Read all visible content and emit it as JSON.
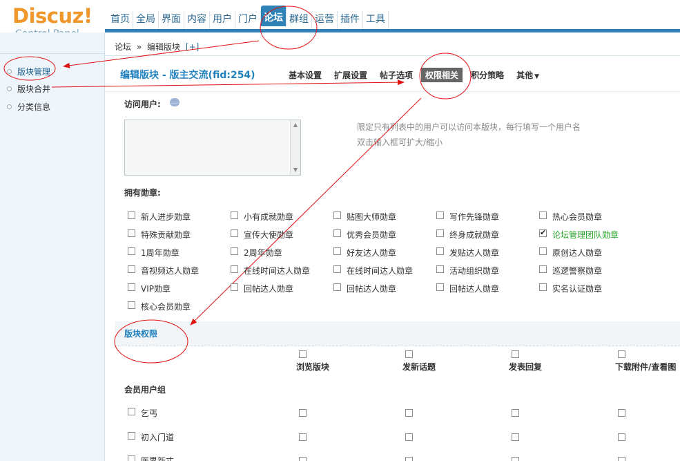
{
  "logo": {
    "brand": "Discuz!",
    "subtitle": "Control Panel"
  },
  "top_nav": [
    "首页",
    "全局",
    "界面",
    "内容",
    "用户",
    "门户",
    "论坛",
    "群组",
    "运营",
    "插件",
    "工具"
  ],
  "top_nav_active": "论坛",
  "sidebar": {
    "items": [
      {
        "label": "版块管理",
        "active": true
      },
      {
        "label": "版块合并",
        "active": false
      },
      {
        "label": "分类信息",
        "active": false
      }
    ]
  },
  "breadcrumb": {
    "root": "论坛",
    "sep": "»",
    "current": "编辑版块",
    "toggle": "[+]"
  },
  "page": {
    "title": "编辑版块 - 版主交流(fid:254)",
    "tabs": [
      "基本设置",
      "扩展设置",
      "帖子选项",
      "权限相关",
      "积分策略",
      "其他"
    ],
    "active_tab": "权限相关",
    "more_caret": "▼"
  },
  "access": {
    "label": "访问用户:",
    "help_icon": "help-bubble-icon",
    "hint1": "限定只有列表中的用户可以访问本版块，每行填写一个用户名",
    "hint2": "双击输入框可扩大/缩小"
  },
  "medals": {
    "label": "拥有勋章:",
    "items": [
      {
        "name": "新人进步勋章",
        "checked": false
      },
      {
        "name": "小有成就勋章",
        "checked": false
      },
      {
        "name": "贴图大师勋章",
        "checked": false
      },
      {
        "name": "写作先锋勋章",
        "checked": false
      },
      {
        "name": "热心会员勋章",
        "checked": false
      },
      {
        "name": "特殊贡献勋章",
        "checked": false
      },
      {
        "name": "宣传大使勋章",
        "checked": false
      },
      {
        "name": "优秀会员勋章",
        "checked": false
      },
      {
        "name": "终身成就勋章",
        "checked": false
      },
      {
        "name": "论坛管理团队勋章",
        "checked": true
      },
      {
        "name": "1周年勋章",
        "checked": false
      },
      {
        "name": "2周年勋章",
        "checked": false
      },
      {
        "name": "好友达人勋章",
        "checked": false
      },
      {
        "name": "发贴达人勋章",
        "checked": false
      },
      {
        "name": "原创达人勋章",
        "checked": false
      },
      {
        "name": "音视频达人勋章",
        "checked": false
      },
      {
        "name": "在线时间达人勋章",
        "checked": false
      },
      {
        "name": "在线时间达人勋章",
        "checked": false
      },
      {
        "name": "活动组织勋章",
        "checked": false
      },
      {
        "name": "巡逻警察勋章",
        "checked": false
      },
      {
        "name": "VIP勋章",
        "checked": false
      },
      {
        "name": "回帖达人勋章",
        "checked": false
      },
      {
        "name": "回帖达人勋章",
        "checked": false
      },
      {
        "name": "回帖达人勋章",
        "checked": false
      },
      {
        "name": "实名认证勋章",
        "checked": false
      },
      {
        "name": "核心会员勋章",
        "checked": false
      }
    ]
  },
  "permissions": {
    "title": "版块权限",
    "columns": [
      "浏览版块",
      "发新话题",
      "发表回复",
      "下载附件/查看图"
    ],
    "group_header": "会员用户组",
    "groups": [
      "乞丐",
      "初入门道",
      "医界新丈"
    ]
  },
  "annotation_color": "#e01010"
}
